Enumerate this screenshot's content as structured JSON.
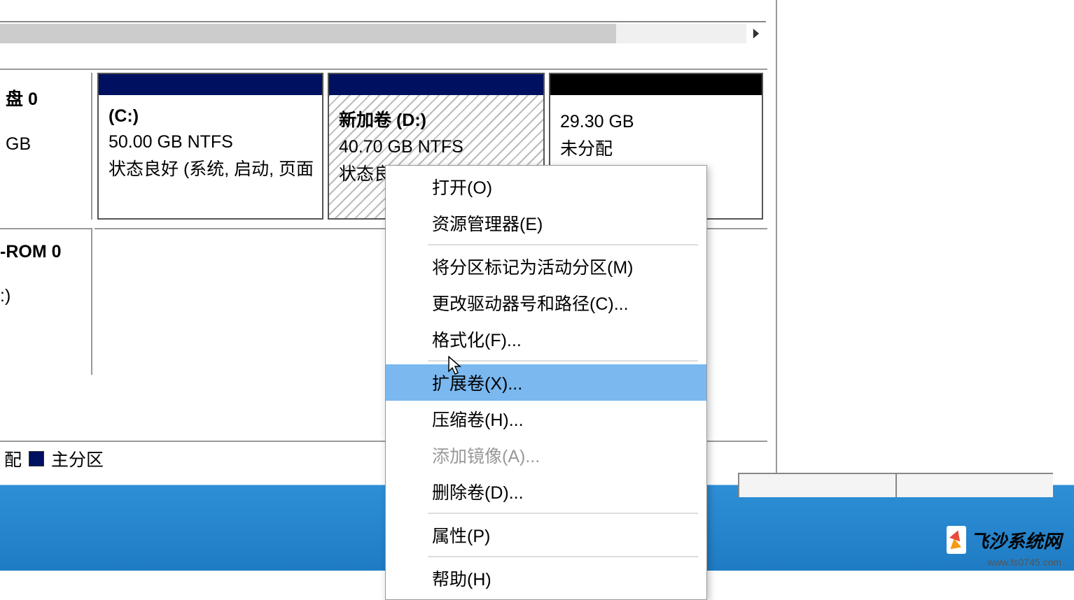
{
  "disk0": {
    "label": "盘 0",
    "size": "GB"
  },
  "cdrom": {
    "label": "-ROM 0",
    "sub": ":)"
  },
  "partitions": {
    "c": {
      "title": "(C:)",
      "info": "50.00 GB NTFS",
      "status": "状态良好 (系统, 启动, 页面)"
    },
    "d": {
      "title": "新加卷  (D:)",
      "info": "40.70 GB NTFS",
      "status": "状态良好 (主分区)"
    },
    "unalloc": {
      "title": "",
      "info": "29.30 GB",
      "status": "未分配"
    }
  },
  "legend": {
    "unallocated_label": "配",
    "primary_label": "主分区"
  },
  "menu": {
    "open": "打开(O)",
    "explorer": "资源管理器(E)",
    "mark_active": "将分区标记为活动分区(M)",
    "change_drive": "更改驱动器号和路径(C)...",
    "format": "格式化(F)...",
    "extend": "扩展卷(X)...",
    "shrink": "压缩卷(H)...",
    "add_mirror": "添加镜像(A)...",
    "delete": "删除卷(D)...",
    "properties": "属性(P)",
    "help": "帮助(H)"
  },
  "watermark": {
    "brand": "飞沙系统网",
    "url": "www.fs0745.com"
  }
}
